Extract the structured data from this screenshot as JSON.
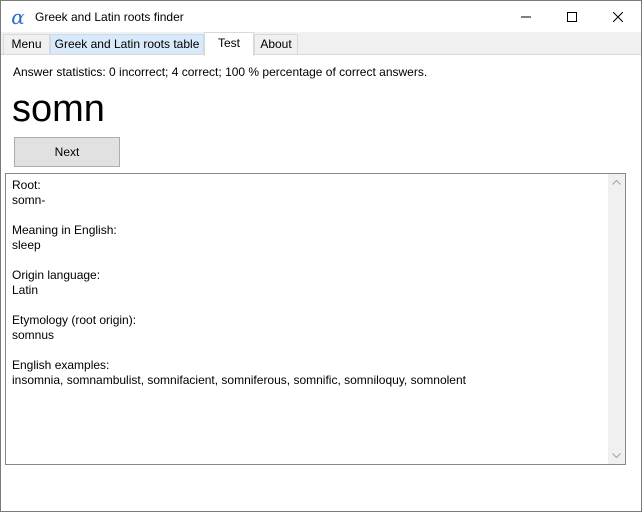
{
  "window": {
    "title": "Greek and Latin roots finder",
    "icon_glyph": "α",
    "icon_name": "alpha-icon",
    "accent": "#2f6cc7"
  },
  "tabs": [
    {
      "label": "Menu"
    },
    {
      "label": "Greek and Latin roots table"
    },
    {
      "label": "Test"
    },
    {
      "label": "About"
    }
  ],
  "test": {
    "stats": "Answer statistics: 0 incorrect; 4 correct; 100 % percentage of correct answers.",
    "root": "somn",
    "next_label": "Next",
    "details": {
      "root_label": "Root:",
      "root_value": "somn-",
      "meaning_label": "Meaning in English:",
      "meaning_value": "sleep",
      "origin_label": "Origin language:",
      "origin_value": "Latin",
      "etymology_label": "Etymology (root origin):",
      "etymology_value": "somnus",
      "examples_label": "English examples:",
      "examples_value": "insomnia, somnambulist, somnifacient, somniferous, somnific, somniloquy, somnolent"
    }
  }
}
